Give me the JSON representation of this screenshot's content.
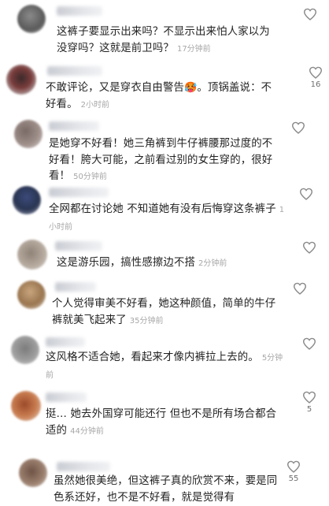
{
  "comments": [
    {
      "text": "这裤子要显示出来吗？不显示出来怕人家以为没穿吗？这就是前卫吗？",
      "time": "17分钟前",
      "likes": ""
    },
    {
      "text": "不敢评论，又是穿衣自由警告",
      "emoji": "🥵",
      "text2": "。顶锅盖说：不好看。",
      "time": "2小时前",
      "likes": "16"
    },
    {
      "text": "是她穿不好看！她三角裤到牛仔裤腰那过度的不好看！胯大可能，之前看过别的女生穿的，很好看！",
      "time": "50分钟前",
      "likes": ""
    },
    {
      "text": "全网都在讨论她 不知道她有没有后悔穿这条裤子",
      "time": "1小时前",
      "likes": ""
    },
    {
      "text": "这是游乐园，搞性感擦边不搭",
      "time": "2分钟前",
      "likes": ""
    },
    {
      "text": "个人觉得审美不好看，她这种颜值，简单的牛仔裤就美飞起来了",
      "time": "35分钟前",
      "likes": ""
    },
    {
      "text": "这风格不适合她，看起来才像内裤拉上去的。",
      "time": "5分钟前",
      "likes": ""
    },
    {
      "text": "挺… 她去外国穿可能还行 但也不是所有场合都合适的",
      "time": "44分钟前",
      "likes": "5"
    },
    {
      "text": "虽然她很美绝，但这裤子真的欣赏不来，要是同色系还好，也不是不好看，就是觉得有",
      "time": "",
      "likes": "55"
    }
  ],
  "colors": {
    "text": "#222222",
    "time": "#a7a7a7",
    "icon": "#8a8a8a"
  },
  "icons": {
    "like": "heart-outline-icon"
  }
}
